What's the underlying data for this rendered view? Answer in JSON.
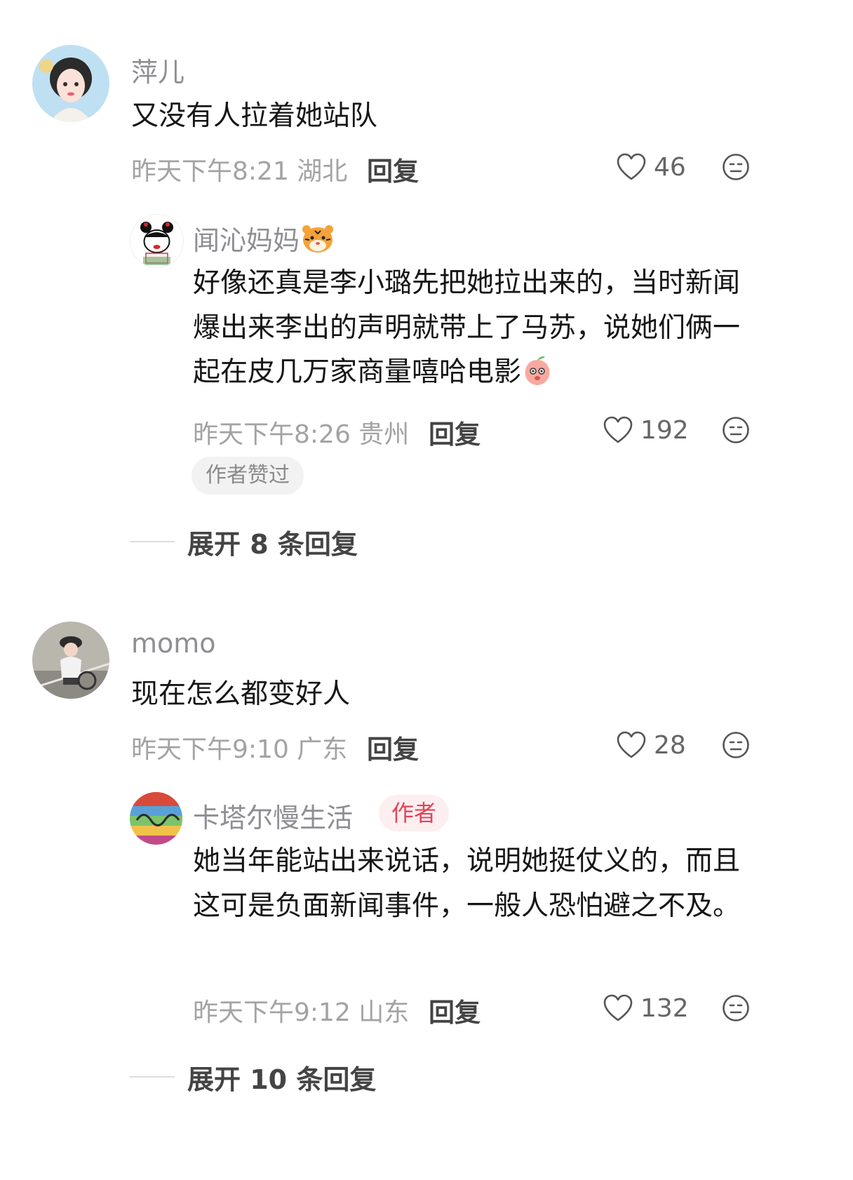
{
  "comments": [
    {
      "username": "萍儿",
      "text": "又没有人拉着她站队",
      "time_location": "昨天下午8:21 湖北",
      "reply_label": "回复",
      "likes": "46",
      "replies": [
        {
          "username": "闻沁妈妈",
          "emoji_name": "tiger-emoji",
          "text": "好像还真是李小璐先把她拉出来的，当时新闻爆出来李出的声明就带上了马苏，说她们俩一起在皮几万家商量嘻哈电影",
          "trailing_emoji": "peach-emoji",
          "time_location": "昨天下午8:26 贵州",
          "reply_label": "回复",
          "likes": "192",
          "liked_badge": "作者赞过"
        }
      ],
      "expand_label": "展开 8 条回复"
    },
    {
      "username": "momo",
      "text": "现在怎么都变好人",
      "time_location": "昨天下午9:10 广东",
      "reply_label": "回复",
      "likes": "28",
      "replies": [
        {
          "username": "卡塔尔慢生活",
          "author_badge": "作者",
          "text": "她当年能站出来说话，说明她挺仗义的，而且这可是负面新闻事件，一般人恐怕避之不及。",
          "time_location": "昨天下午9:12 山东",
          "reply_label": "回复",
          "likes": "132"
        }
      ],
      "expand_label": "展开 10 条回复"
    }
  ],
  "colors": {
    "username": "#8e8e93",
    "body_text": "#161616",
    "meta": "#a3a3a3",
    "author_badge_text": "#e24359",
    "author_badge_bg": "#fdeef0"
  },
  "icons": {
    "like": "heart-outline-icon",
    "dislike": "neutral-face-icon"
  }
}
